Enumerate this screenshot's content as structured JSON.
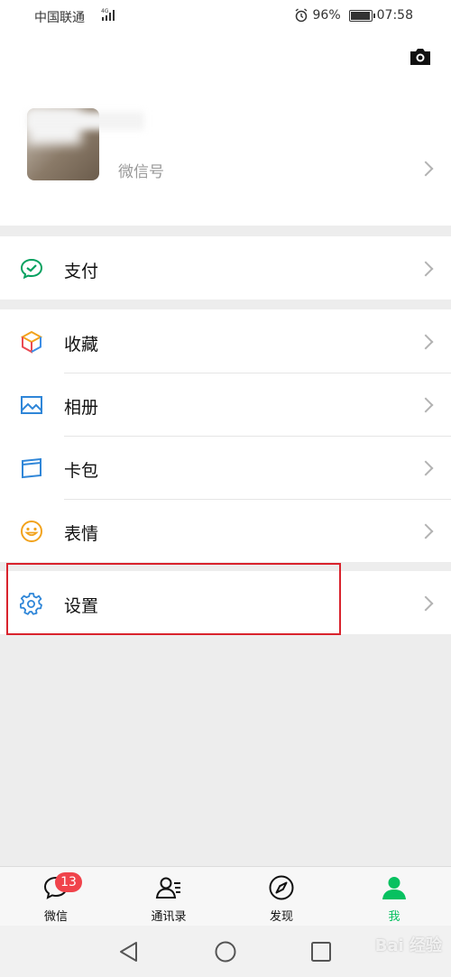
{
  "status_bar": {
    "carrier": "中国联通",
    "network": "4G",
    "battery": "96%",
    "time": "07:58",
    "battery_level": 0.96
  },
  "profile": {
    "wechat_id_label": "微信号"
  },
  "menu": {
    "pay": "支付",
    "favorites": "收藏",
    "album": "相册",
    "cards": "卡包",
    "stickers": "表情",
    "settings": "设置"
  },
  "tabbar": {
    "chats": "微信",
    "chats_badge": "13",
    "contacts": "通讯录",
    "discover": "发现",
    "me": "我",
    "active_color": "#07c160"
  },
  "watermark": "Bai 经验",
  "colors": {
    "accent": "#07c160",
    "highlight": "#d9232d",
    "badge": "#f0434b"
  }
}
